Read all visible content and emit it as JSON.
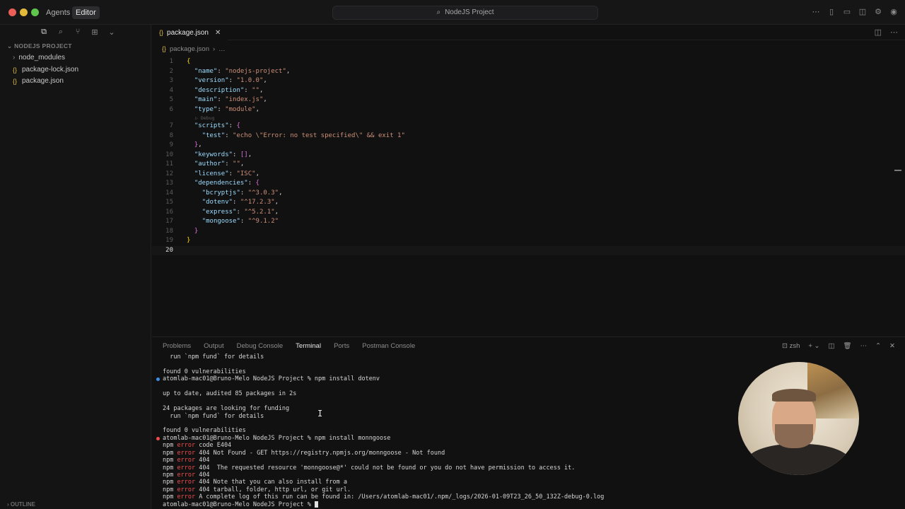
{
  "titlebar": {
    "agents_label": "Agents",
    "editor_label": "Editor",
    "command_center": "NodeJS Project"
  },
  "sidebar": {
    "explorer_title": "NODEJS PROJECT",
    "items": [
      {
        "label": "node_modules",
        "kind": "folder"
      },
      {
        "label": "package-lock.json",
        "kind": "json"
      },
      {
        "label": "package.json",
        "kind": "json"
      }
    ],
    "outline_label": "OUTLINE"
  },
  "editor": {
    "tab_label": "package.json",
    "breadcrumb_file": "package.json",
    "breadcrumb_more": "…",
    "codelens_debug": "▷ Debug",
    "lines": [
      {
        "n": "1"
      },
      {
        "n": "2"
      },
      {
        "n": "3"
      },
      {
        "n": "4"
      },
      {
        "n": "5"
      },
      {
        "n": "6"
      },
      {
        "n": "7"
      },
      {
        "n": "8"
      },
      {
        "n": "9"
      },
      {
        "n": "10"
      },
      {
        "n": "11"
      },
      {
        "n": "12"
      },
      {
        "n": "13"
      },
      {
        "n": "14"
      },
      {
        "n": "15"
      },
      {
        "n": "16"
      },
      {
        "n": "17"
      },
      {
        "n": "18"
      },
      {
        "n": "19"
      },
      {
        "n": "20"
      }
    ],
    "code": {
      "name_key": "\"name\"",
      "name_val": "\"nodejs-project\"",
      "version_key": "\"version\"",
      "version_val": "\"1.0.0\"",
      "description_key": "\"description\"",
      "description_val": "\"\"",
      "main_key": "\"main\"",
      "main_val": "\"index.js\"",
      "type_key": "\"type\"",
      "type_val": "\"module\"",
      "scripts_key": "\"scripts\"",
      "test_key": "\"test\"",
      "test_val": "\"echo \\\"Error: no test specified\\\" && exit 1\"",
      "keywords_key": "\"keywords\"",
      "author_key": "\"author\"",
      "author_val": "\"\"",
      "license_key": "\"license\"",
      "license_val": "\"ISC\"",
      "dependencies_key": "\"dependencies\"",
      "bcryptjs_key": "\"bcryptjs\"",
      "bcryptjs_val": "\"^3.0.3\"",
      "dotenv_key": "\"dotenv\"",
      "dotenv_val": "\"^17.2.3\"",
      "express_key": "\"express\"",
      "express_val": "\"^5.2.1\"",
      "mongoose_key": "\"mongoose\"",
      "mongoose_val": "\"^9.1.2\""
    }
  },
  "panel": {
    "tabs": [
      "Problems",
      "Output",
      "Debug Console",
      "Terminal",
      "Ports",
      "Postman Console"
    ],
    "active_tab": "Terminal",
    "shell": "zsh",
    "terminal_lines": [
      {
        "text": "  run `npm fund` for details"
      },
      {
        "text": ""
      },
      {
        "text": "found 0 vulnerabilities"
      },
      {
        "text": "atomlab-mac01@Bruno-Melo NodeJS Project % npm install dotenv"
      },
      {
        "text": ""
      },
      {
        "text": "up to date, audited 85 packages in 2s"
      },
      {
        "text": ""
      },
      {
        "text": "24 packages are looking for funding"
      },
      {
        "text": "  run `npm fund` for details"
      },
      {
        "text": ""
      },
      {
        "text": "found 0 vulnerabilities"
      },
      {
        "text": "atomlab-mac01@Bruno-Melo NodeJS Project % npm install monngoose"
      },
      {
        "npm": "npm",
        "err": "error",
        "rest": " code E404"
      },
      {
        "npm": "npm",
        "err": "error",
        "rest": " 404 Not Found - GET https://registry.npmjs.org/monngoose - Not found"
      },
      {
        "npm": "npm",
        "err": "error",
        "rest": " 404"
      },
      {
        "npm": "npm",
        "err": "error",
        "rest": " 404  The requested resource 'monngoose@*' could not be found or you do not have permission to access it."
      },
      {
        "npm": "npm",
        "err": "error",
        "rest": " 404"
      },
      {
        "npm": "npm",
        "err": "error",
        "rest": " 404 Note that you can also install from a"
      },
      {
        "npm": "npm",
        "err": "error",
        "rest": " 404 tarball, folder, http url, or git url."
      },
      {
        "npm": "npm",
        "err": "error",
        "rest": " A complete log of this run can be found in: /Users/atomlab-mac01/.npm/_logs/2026-01-09T23_26_50_132Z-debug-0.log"
      },
      {
        "text": "atomlab-mac01@Bruno-Melo NodeJS Project % "
      }
    ]
  },
  "colors": {
    "accent_json": "#d7b93f",
    "error_red": "#f14c4c",
    "prompt_blue": "#3b8eea"
  }
}
